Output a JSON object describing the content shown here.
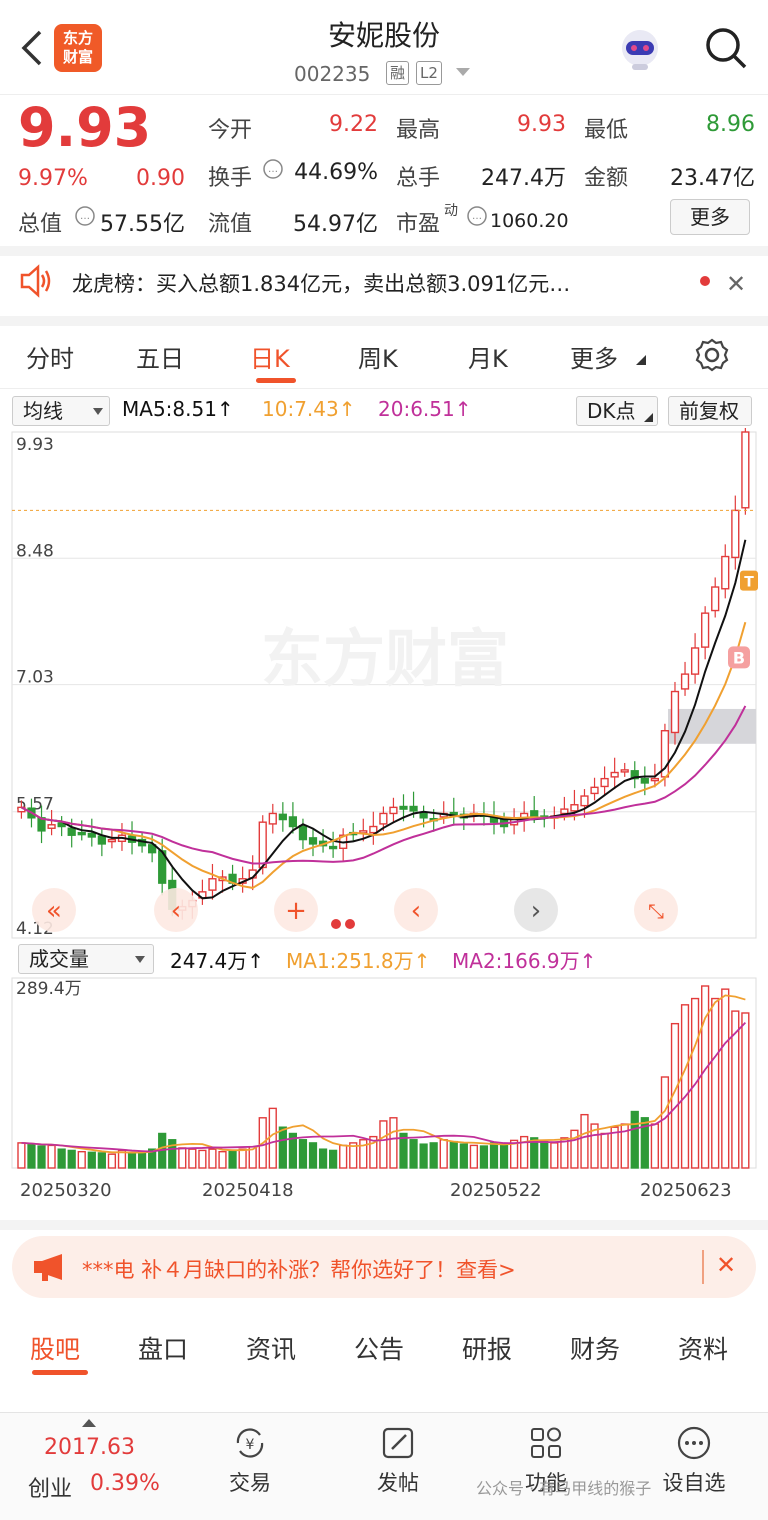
{
  "header": {
    "title": "安妮股份",
    "code": "002235",
    "tag_margin": "融",
    "tag_level": "L2",
    "logo_line1": "东方",
    "logo_line2": "财富"
  },
  "quote": {
    "price": "9.93",
    "change_pct": "9.97%",
    "change_amt": "0.90",
    "open_label": "今开",
    "open": "9.22",
    "high_label": "最高",
    "high": "9.93",
    "low_label": "最低",
    "low": "8.96",
    "turnover_label": "换手",
    "turnover": "44.69%",
    "volume_label": "总手",
    "volume": "247.4万",
    "amount_label": "金额",
    "amount": "23.47亿",
    "mktcap_label": "总值",
    "mktcap": "57.55亿",
    "float_label": "流值",
    "float": "54.97亿",
    "pe_label": "市盈",
    "pe_sup": "动",
    "pe": "1060.20",
    "more_label": "更多"
  },
  "dragon": {
    "text": "龙虎榜：买入总额1.834亿元，卖出总额3.091亿元…"
  },
  "ktabs": [
    "分时",
    "五日",
    "日K",
    "周K",
    "月K",
    "更多"
  ],
  "indicators": {
    "ma_select": "均线",
    "ma5": "MA5:8.51↑",
    "ma10": "10:7.43↑",
    "ma20": "20:6.51↑",
    "dk": "DK点",
    "adjust": "前复权",
    "colors": {
      "ma5": "#111111",
      "ma10": "#f0a030",
      "ma20": "#c0309a"
    }
  },
  "chart_data": {
    "type": "candlestick",
    "y_ticks": [
      "9.93",
      "8.48",
      "7.03",
      "5.57",
      "4.12"
    ],
    "ylim": [
      4.12,
      9.93
    ],
    "x_labels": [
      "20250320",
      "20250418",
      "20250522",
      "20250623"
    ],
    "watermark": "东方财富",
    "markers": [
      "B",
      "T"
    ],
    "closes": [
      5.62,
      5.5,
      5.35,
      5.42,
      5.4,
      5.3,
      5.32,
      5.28,
      5.2,
      5.25,
      5.3,
      5.22,
      5.18,
      5.1,
      4.75,
      4.45,
      4.48,
      4.55,
      4.65,
      4.8,
      4.82,
      4.75,
      4.8,
      4.9,
      5.45,
      5.55,
      5.48,
      5.4,
      5.25,
      5.2,
      5.18,
      5.15,
      5.3,
      5.32,
      5.35,
      5.4,
      5.55,
      5.62,
      5.6,
      5.58,
      5.5,
      5.48,
      5.55,
      5.52,
      5.5,
      5.55,
      5.52,
      5.45,
      5.4,
      5.5,
      5.55,
      5.52,
      5.5,
      5.52,
      5.6,
      5.65,
      5.75,
      5.85,
      5.95,
      6.02,
      6.05,
      5.95,
      5.9,
      5.95,
      6.5,
      6.95,
      7.15,
      7.45,
      7.85,
      8.15,
      8.5,
      9.03,
      9.93
    ],
    "volume": {
      "label": "成交量",
      "value": "247.4万↑",
      "ma1": "MA1:251.8万↑",
      "ma2": "MA2:166.9万↑",
      "max_label": "289.4万",
      "values": [
        40,
        38,
        35,
        36,
        30,
        28,
        26,
        25,
        24,
        22,
        28,
        24,
        26,
        30,
        55,
        45,
        32,
        30,
        28,
        30,
        26,
        28,
        30,
        34,
        80,
        95,
        65,
        55,
        45,
        40,
        30,
        28,
        36,
        40,
        45,
        50,
        75,
        80,
        55,
        45,
        38,
        40,
        45,
        42,
        38,
        36,
        35,
        40,
        38,
        44,
        50,
        48,
        42,
        40,
        48,
        60,
        85,
        70,
        55,
        65,
        70,
        90,
        80,
        70,
        145,
        230,
        260,
        270,
        290,
        270,
        285,
        250,
        247
      ]
    }
  },
  "ad": {
    "text": "***电 补４月缺口的补涨？帮你选好了！查看>"
  },
  "btabs": [
    "股吧",
    "盘口",
    "资讯",
    "公告",
    "研报",
    "财务",
    "资料"
  ],
  "footer": {
    "index_value": "2017.63",
    "index_name": "创业",
    "index_change": "0.39%",
    "trade": "交易",
    "post": "发帖",
    "func": "功能",
    "watch": "设自选",
    "watermark": "公众号 · 有马甲线的猴子"
  }
}
